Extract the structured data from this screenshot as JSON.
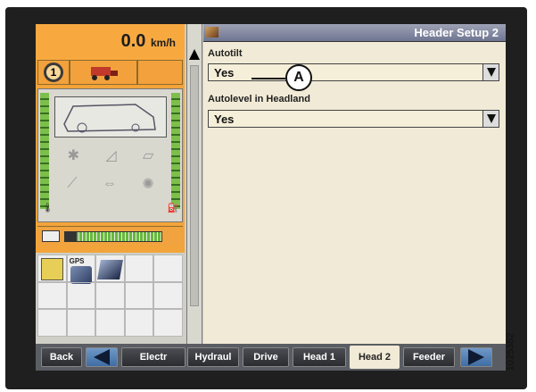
{
  "status": {
    "speed_value": "0.0",
    "speed_unit": "km/h",
    "gear_number": "1"
  },
  "header": {
    "title": "Header Setup 2"
  },
  "settings": [
    {
      "label": "Autotilt",
      "value": "Yes"
    },
    {
      "label": "Autolevel in Headland",
      "value": "Yes"
    }
  ],
  "callout": {
    "letter": "A"
  },
  "grid": {
    "gps_label": "GPS"
  },
  "tabs": {
    "back": "Back",
    "items": [
      "Electr",
      "Hydraul",
      "Drive",
      "Head 1",
      "Head 2",
      "Feeder"
    ],
    "active": "Head 2"
  },
  "figure_id": "1025382",
  "icons": [
    "gear-icon",
    "combine-icon",
    "fuel-icon",
    "gps-icon",
    "dropdown-arrow-icon",
    "scroll-up-icon",
    "arrow-left-icon",
    "arrow-right-icon"
  ]
}
